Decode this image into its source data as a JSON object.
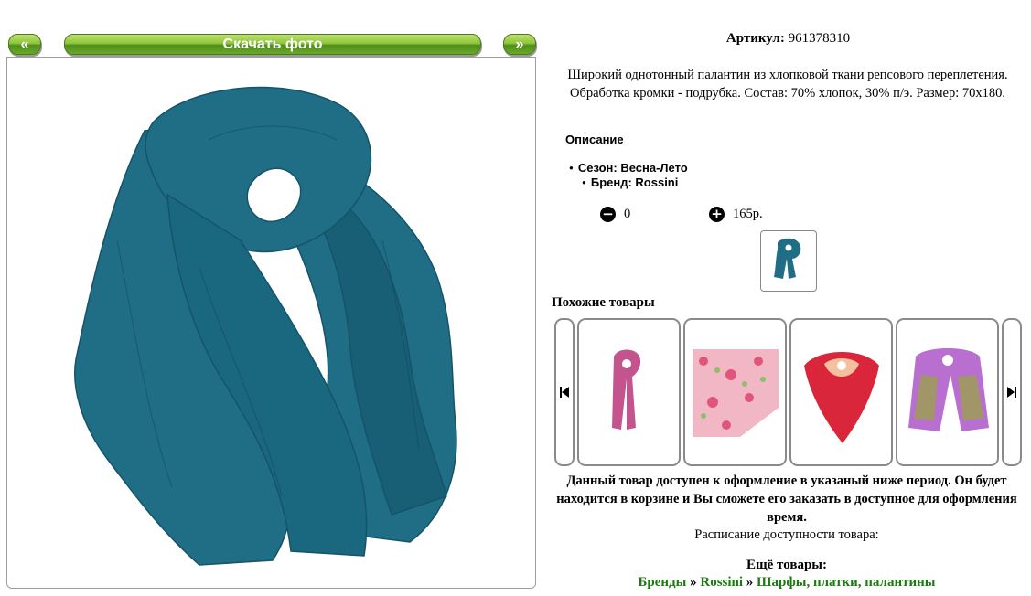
{
  "nav": {
    "prev_label": "«",
    "download_label": "Скачать фото",
    "next_label": "»"
  },
  "product": {
    "sku_label": "Артикул:",
    "sku_value": "961378310",
    "description": "Широкий однотонный палантин из хлопковой ткани репсового переплетения. Обработка кромки - подрубка. Состав: 70% хлопок, 30% п/э. Размер: 70х180.",
    "main_image_color": "#1f6e86"
  },
  "details": {
    "heading": "Описание",
    "season": "Сезон: Весна-Лето",
    "brand": "Бренд: Rossini"
  },
  "cart": {
    "qty_value": "0",
    "price": "165р."
  },
  "similar": {
    "heading": "Похожие товары",
    "items": [
      {
        "color": "#c4548e"
      },
      {
        "color": "#e98aa6"
      },
      {
        "color": "#d9263a"
      },
      {
        "color": "#b86fcf"
      }
    ]
  },
  "availability": {
    "notice": "Данный товар доступен к оформление в указаный ниже период. Он будет находится в корзине и Вы сможете его заказать в доступное для оформления время.",
    "schedule_label": "Расписание доступности товара:"
  },
  "more": {
    "heading": "Ещё товары:",
    "crumbs": [
      "Бренды",
      "Rossini",
      "Шарфы, платки, палантины"
    ],
    "separator": "»"
  }
}
